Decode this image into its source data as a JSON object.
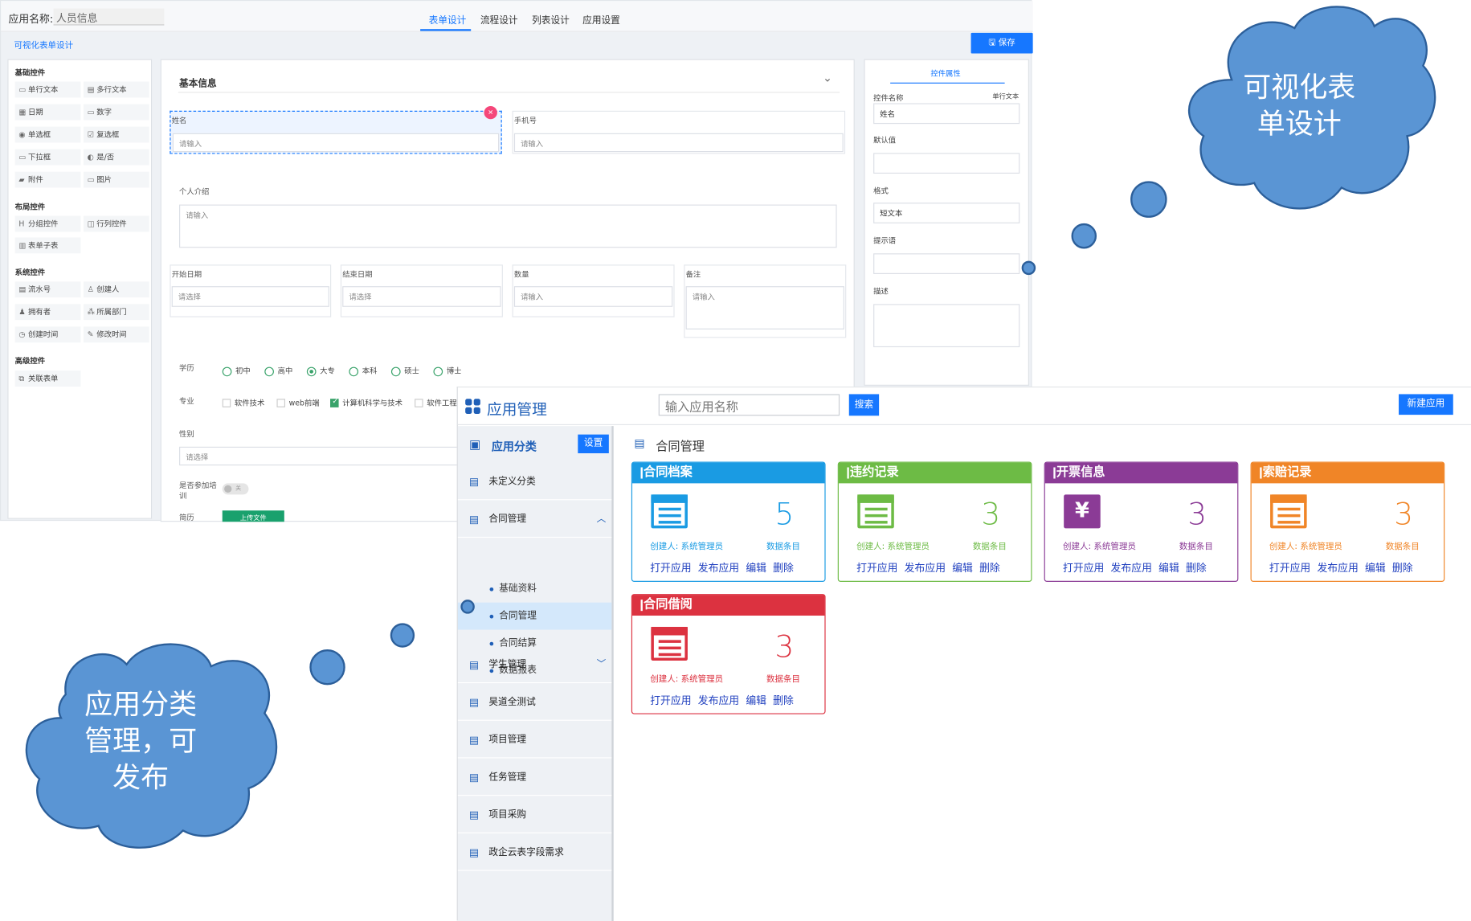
{
  "designer": {
    "app_name_label": "应用名称:",
    "app_name_value": "人员信息",
    "tabs": [
      "表单设计",
      "流程设计",
      "列表设计",
      "应用设置"
    ],
    "subtitle": "可视化表单设计",
    "save": "保存",
    "groups": {
      "basic": "基础控件",
      "layout": "布局控件",
      "system": "系统控件",
      "advanced": "高级控件"
    },
    "controls_basic": [
      "单行文本",
      "多行文本",
      "日期",
      "数字",
      "单选框",
      "复选框",
      "下拉框",
      "是/否",
      "附件",
      "图片"
    ],
    "controls_layout": [
      "分组控件",
      "行列控件",
      "表单子表"
    ],
    "controls_system": [
      "流水号",
      "创建人",
      "拥有者",
      "所属部门",
      "创建时间",
      "修改时间"
    ],
    "controls_advanced": [
      "关联表单"
    ],
    "section": "基本信息",
    "form": {
      "name": "姓名",
      "phone": "手机号",
      "ph_input": "请输入",
      "ph_select": "请选择",
      "intro": "个人介绍",
      "start_date": "开始日期",
      "end_date": "结束日期",
      "qty": "数量",
      "remark": "备注",
      "edu": "学历",
      "edu_opts": [
        "初中",
        "高中",
        "大专",
        "本科",
        "硕士",
        "博士"
      ],
      "major": "专业",
      "major_opts": [
        "软件技术",
        "web前端",
        "计算机科学与技术",
        "软件工程"
      ],
      "gender": "性别",
      "training": "是否参加培训",
      "training_toggle": "关",
      "resume": "简历",
      "upload": "上传文件"
    },
    "props": {
      "tab": "控件属性",
      "ctl_name": "控件名称",
      "ctl_type": "单行文本",
      "ctl_value": "姓名",
      "default": "默认值",
      "format": "格式",
      "format_value": "短文本",
      "hint": "提示语",
      "desc": "描述"
    }
  },
  "manager": {
    "title": "应用管理",
    "search_placeholder": "输入应用名称",
    "search_btn": "搜索",
    "new_btn": "新建应用",
    "side_title": "应用分类",
    "side_btn": "设置",
    "categories": [
      "未定义分类",
      "合同管理",
      "学生管理",
      "昊道全测试",
      "项目管理",
      "任务管理",
      "项目采购",
      "政企云表字段需求"
    ],
    "subitems": [
      "基础资料",
      "合同管理",
      "合同结算",
      "数据报表"
    ],
    "breadcrumb": "合同管理",
    "meta_creator": "创建人: 系统管理员",
    "meta_count": "数据条目",
    "actions": [
      "打开应用",
      "发布应用",
      "编辑",
      "删除"
    ],
    "cards": [
      {
        "name": "合同档案",
        "count": "5",
        "color": "#1a9be3"
      },
      {
        "name": "违约记录",
        "count": "3",
        "color": "#6dbb45"
      },
      {
        "name": "开票信息",
        "count": "3",
        "color": "#8b3b96"
      },
      {
        "name": "索赔记录",
        "count": "3",
        "color": "#f08527"
      },
      {
        "name": "合同借阅",
        "count": "3",
        "color": "#dc3240"
      }
    ]
  },
  "callouts": {
    "top": [
      "可视化表",
      "单设计"
    ],
    "bottom": [
      "应用分类",
      "管理，可",
      "发布"
    ]
  }
}
